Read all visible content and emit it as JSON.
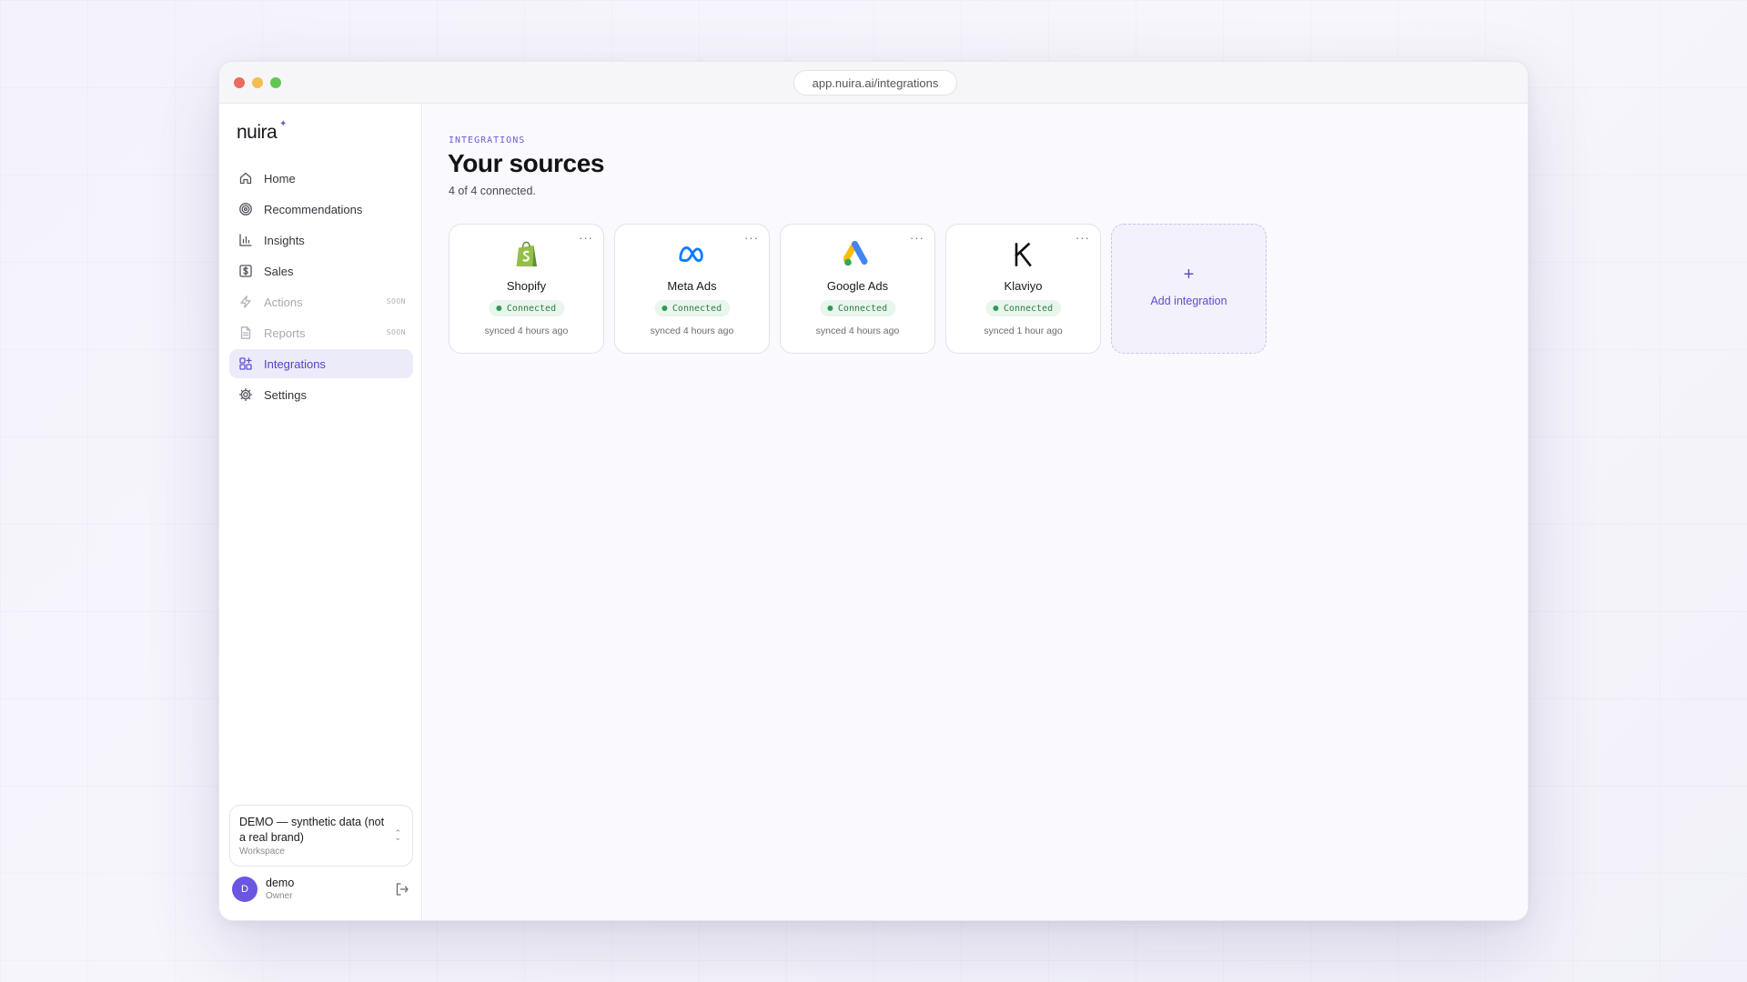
{
  "browser": {
    "url": "app.nuira.ai/integrations"
  },
  "brand": {
    "name": "nuira",
    "mark": "✦",
    "accent": "#6b5cd6"
  },
  "sidebar": {
    "items": [
      {
        "label": "Home",
        "icon": "home-icon"
      },
      {
        "label": "Recommendations",
        "icon": "target-icon"
      },
      {
        "label": "Insights",
        "icon": "bar-chart-icon"
      },
      {
        "label": "Sales",
        "icon": "dollar-icon"
      },
      {
        "label": "Actions",
        "icon": "bolt-icon",
        "badge": "SOON"
      },
      {
        "label": "Reports",
        "icon": "document-icon",
        "badge": "SOON"
      },
      {
        "label": "Integrations",
        "icon": "grid-plus-icon",
        "active": true
      },
      {
        "label": "Settings",
        "icon": "gear-icon"
      }
    ],
    "workspace": {
      "name": "DEMO — synthetic data (not a real brand)",
      "label": "Workspace"
    },
    "user": {
      "initial": "D",
      "name": "demo",
      "role": "Owner"
    }
  },
  "page": {
    "eyebrow": "INTEGRATIONS",
    "title": "Your sources",
    "subtitle": "4 of 4 connected.",
    "menu": "···",
    "cards": [
      {
        "name": "Shopify",
        "status": "Connected",
        "synced": "synced 4 hours ago",
        "icon": "shopify-icon"
      },
      {
        "name": "Meta Ads",
        "status": "Connected",
        "synced": "synced 4 hours ago",
        "icon": "meta-icon"
      },
      {
        "name": "Google Ads",
        "status": "Connected",
        "synced": "synced 4 hours ago",
        "icon": "google-ads-icon"
      },
      {
        "name": "Klaviyo",
        "status": "Connected",
        "synced": "synced 1 hour ago",
        "icon": "klaviyo-icon"
      }
    ],
    "add": {
      "plus": "+",
      "label": "Add integration"
    }
  }
}
